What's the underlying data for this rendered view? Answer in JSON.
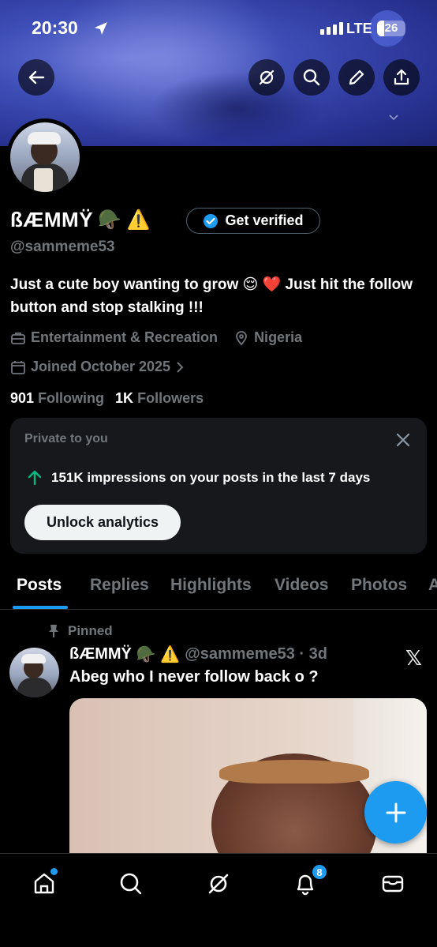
{
  "status_bar": {
    "time": "20:30",
    "network": "LTE",
    "battery": "26"
  },
  "profile": {
    "display_name": "ßÆMMŸ",
    "name_emojis": "🪖 ⚠️",
    "verify_label": "Get verified",
    "handle": "@sammeme53",
    "bio": "Just a cute boy wanting to grow 😌 ❤️ Just hit the follow button and stop stalking !!!",
    "category": "Entertainment & Recreation",
    "location": "Nigeria",
    "joined": "Joined October 2025",
    "following_count": "901",
    "following_label": "Following",
    "followers_count": "1K",
    "followers_label": "Followers"
  },
  "analytics_card": {
    "title": "Private to you",
    "stat": "151K impressions on your posts in the last 7 days",
    "button": "Unlock analytics"
  },
  "tabs": [
    "Posts",
    "Replies",
    "Highlights",
    "Videos",
    "Photos",
    "A"
  ],
  "post": {
    "pinned_label": "Pinned",
    "author_name": "ßÆMMŸ",
    "author_emojis": "🪖 ⚠️",
    "author_handle_time": "@sammeme53 · 3d",
    "text": "Abeg who I never follow back o ?"
  },
  "nav": {
    "notifications_badge": "8"
  },
  "colors": {
    "accent": "#1d9bf0",
    "background": "#000000",
    "muted_text": "#71767b",
    "stat_arrow": "#00ba7c"
  }
}
